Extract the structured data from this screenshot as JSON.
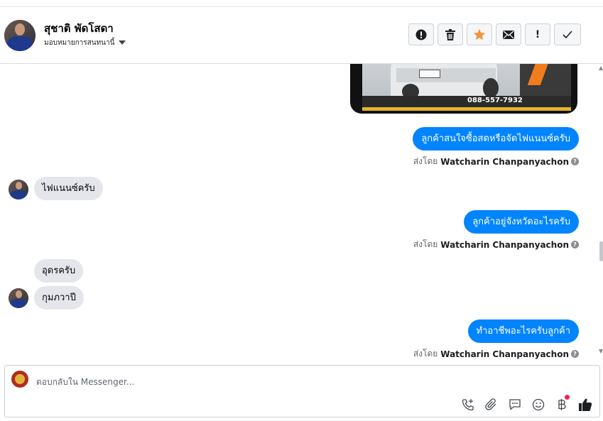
{
  "header": {
    "contact_name": "สุชาติ พัดโสดา",
    "assign_label": "มอบหมายการสนทนานี้",
    "actions": [
      {
        "icon": "alert-circle-icon",
        "label": "!"
      },
      {
        "icon": "trash-icon",
        "label": ""
      },
      {
        "icon": "star-icon",
        "label": ""
      },
      {
        "icon": "envelope-icon",
        "label": ""
      },
      {
        "icon": "exclamation-icon",
        "label": "!"
      },
      {
        "icon": "check-icon",
        "label": ""
      }
    ]
  },
  "photo": {
    "phone_text": "088-557-7932"
  },
  "messages": [
    {
      "direction": "out",
      "text": "ลูกค้าสนใจซื้อสดหรือจัดไฟแนนซ์ครับ",
      "sent_by_label": "ส่งโดย",
      "sender": "Watcharin Chanpanyachon"
    },
    {
      "direction": "in",
      "text": "ไฟแนนซ์ครับ"
    },
    {
      "direction": "out",
      "text": "ลูกค้าอยู่จังหวัดอะไรครับ",
      "sent_by_label": "ส่งโดย",
      "sender": "Watcharin Chanpanyachon"
    },
    {
      "direction": "in",
      "text": "อุดรครับ"
    },
    {
      "direction": "in",
      "text": "กุมภวาปี"
    },
    {
      "direction": "out",
      "text": "ทำอาชีพอะไรครับลูกค้า",
      "sent_by_label": "ส่งโดย",
      "sender": "Watcharin Chanpanyachon"
    }
  ],
  "composer": {
    "placeholder": "ตอบกลับใน Messenger..."
  },
  "colors": {
    "outgoing_bubble": "#0084ff",
    "incoming_bubble": "#e4e6eb",
    "star": "#f7923b",
    "notification_dot": "#f02849"
  }
}
